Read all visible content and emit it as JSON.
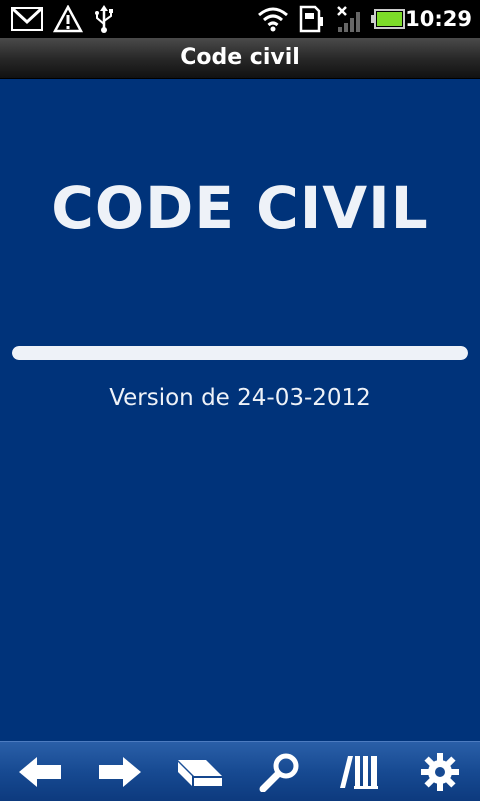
{
  "status_bar": {
    "time": "10:29",
    "icons": [
      "gmail-icon",
      "warning-icon",
      "usb-icon",
      "wifi-icon",
      "sd-card-icon",
      "signal-icon",
      "battery-icon"
    ]
  },
  "title_bar": {
    "title": "Code civil"
  },
  "main": {
    "heading": "CODE CIVIL",
    "progress": 1.0,
    "version": "Version de 24-03-2012"
  },
  "toolbar": {
    "buttons": [
      "back-icon",
      "forward-icon",
      "book-icon",
      "search-icon",
      "library-icon",
      "settings-icon"
    ]
  },
  "colors": {
    "background": "#00337a",
    "text": "#eef2f8",
    "toolbar": "#174a92"
  }
}
